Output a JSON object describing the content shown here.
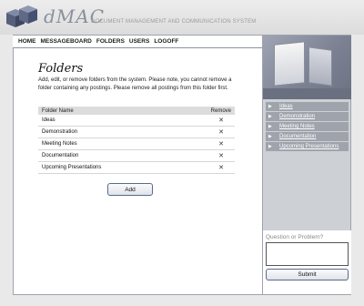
{
  "header": {
    "brand_name": "dMAC",
    "brand_tagline": "DOCUMENT MANAGEMENT AND COMMUNICATION SYSTEM"
  },
  "nav": {
    "items": [
      "HOME",
      "MESSAGEBOARD",
      "FOLDERS",
      "USERS",
      "LOGOFF"
    ]
  },
  "main": {
    "title": "Folders",
    "description": "Add, edit, or remove folders from the system. Please note, you cannot remove a folder containing any postings. Please remove all postings from this folder first.",
    "table": {
      "columns": [
        "Folder Name",
        "Remove"
      ],
      "rows": [
        {
          "name": "Ideas",
          "remove": "✕"
        },
        {
          "name": "Demonstration",
          "remove": "✕"
        },
        {
          "name": "Meeting Notes",
          "remove": "✕"
        },
        {
          "name": "Documentation",
          "remove": "✕"
        },
        {
          "name": "Upcoming Presentations",
          "remove": "✕"
        }
      ]
    },
    "add_label": "Add"
  },
  "sidebar": {
    "links": [
      "Ideas",
      "Demonstration",
      "Meeting Notes",
      "Documentation",
      "Upcoming Presentations"
    ],
    "question_label": "Question or Problem?",
    "submit_label": "Submit"
  },
  "colors": {
    "frame_border": "#9ea3ad",
    "sidebar_bg": "#cdd0d5",
    "link_bg": "#9ea3ac",
    "table_header_bg": "#dcdcdc"
  }
}
